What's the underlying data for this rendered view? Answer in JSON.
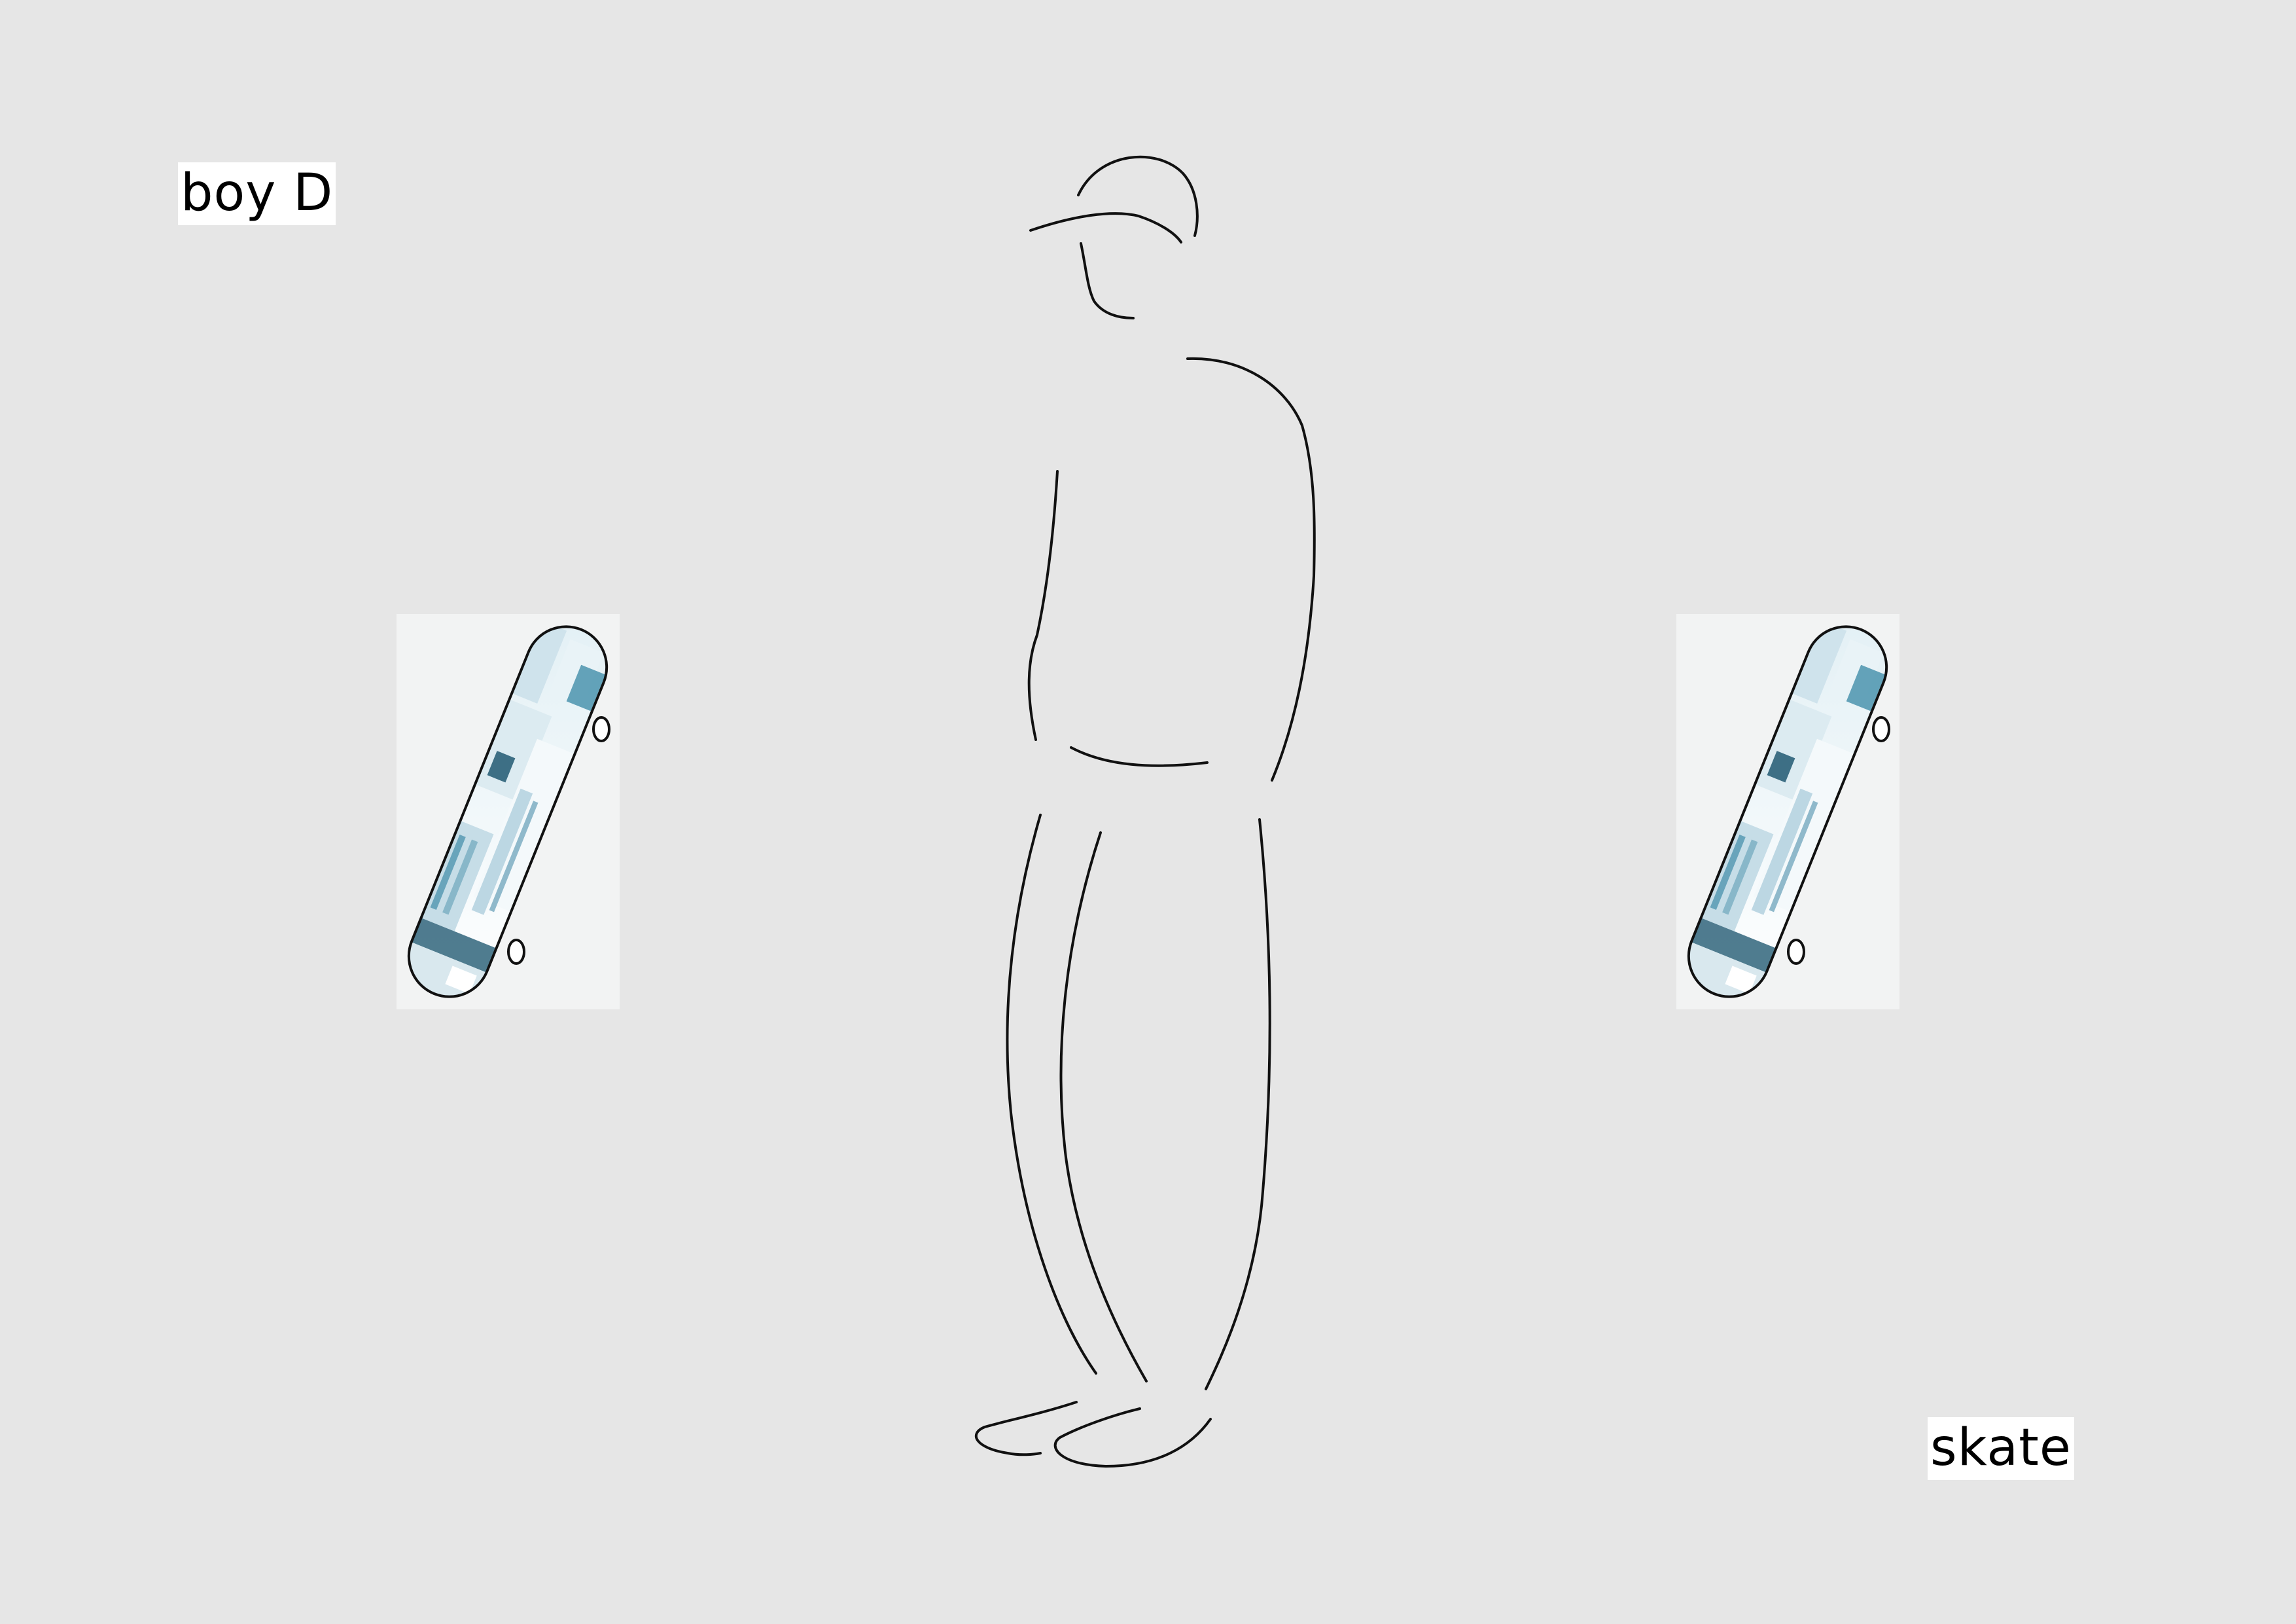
{
  "labels": {
    "title": "boy D",
    "caption": "skate"
  },
  "colors": {
    "background": "#e6e6e6",
    "label_bg": "#ffffff",
    "line": "#111111",
    "board_card": "#f2f3f3",
    "board_sky": "#eef5f8",
    "board_building": "#d2e6ee",
    "board_accent": "#2a7f9e",
    "board_dark": "#15506a"
  },
  "icons": {
    "figure": "line-drawing-boy-icon",
    "board": "skateboard-icon"
  }
}
